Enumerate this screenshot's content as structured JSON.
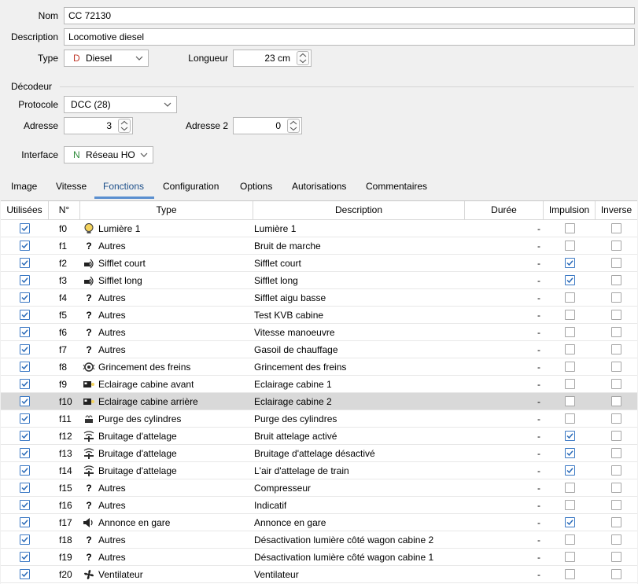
{
  "form": {
    "nom_label": "Nom",
    "nom_value": "CC 72130",
    "description_label": "Description",
    "description_value": "Locomotive diesel",
    "type_label": "Type",
    "type_prefix": "D",
    "type_value": "Diesel",
    "longueur_label": "Longueur",
    "longueur_value": "23 cm"
  },
  "decodeur": {
    "section_label": "Décodeur",
    "protocole_label": "Protocole",
    "protocole_value": "DCC (28)",
    "adresse_label": "Adresse",
    "adresse_value": "3",
    "adresse2_label": "Adresse 2",
    "adresse2_value": "0",
    "interface_label": "Interface",
    "interface_prefix": "N",
    "interface_value": "Réseau HO"
  },
  "colors": {
    "accent": "#3a78c4",
    "type_prefix": "#c0392b",
    "interface_prefix": "#2e8b3a",
    "selected_row": "#d9d9d9"
  },
  "tabs": [
    {
      "label": "Image"
    },
    {
      "label": "Vitesse"
    },
    {
      "label": "Fonctions",
      "active": true
    },
    {
      "label": "Configuration"
    },
    {
      "label": "Options"
    },
    {
      "label": "Autorisations"
    },
    {
      "label": "Commentaires"
    }
  ],
  "table": {
    "headers": [
      "Utilisées",
      "N°",
      "Type",
      "Description",
      "Durée",
      "Impulsion",
      "Inverse"
    ],
    "rows": [
      {
        "used": true,
        "n": "f0",
        "icon": "bulb-icon",
        "type": "Lumière 1",
        "description": "Lumière 1",
        "duree": "-",
        "impulsion": false,
        "inverse": false
      },
      {
        "used": true,
        "n": "f1",
        "icon": "question-icon",
        "type": "Autres",
        "description": "Bruit de marche",
        "duree": "-",
        "impulsion": false,
        "inverse": false
      },
      {
        "used": true,
        "n": "f2",
        "icon": "whistle-icon",
        "type": "Sifflet court",
        "description": "Sifflet court",
        "duree": "-",
        "impulsion": true,
        "inverse": false
      },
      {
        "used": true,
        "n": "f3",
        "icon": "whistle-icon",
        "type": "Sifflet long",
        "description": "Sifflet long",
        "duree": "-",
        "impulsion": true,
        "inverse": false
      },
      {
        "used": true,
        "n": "f4",
        "icon": "question-icon",
        "type": "Autres",
        "description": "Sifflet aigu basse",
        "duree": "-",
        "impulsion": false,
        "inverse": false
      },
      {
        "used": true,
        "n": "f5",
        "icon": "question-icon",
        "type": "Autres",
        "description": "Test KVB cabine",
        "duree": "-",
        "impulsion": false,
        "inverse": false
      },
      {
        "used": true,
        "n": "f6",
        "icon": "question-icon",
        "type": "Autres",
        "description": "Vitesse manoeuvre",
        "duree": "-",
        "impulsion": false,
        "inverse": false
      },
      {
        "used": true,
        "n": "f7",
        "icon": "question-icon",
        "type": "Autres",
        "description": "Gasoil de chauffage",
        "duree": "-",
        "impulsion": false,
        "inverse": false
      },
      {
        "used": true,
        "n": "f8",
        "icon": "brake-icon",
        "type": "Grincement des freins",
        "description": "Grincement des freins",
        "duree": "-",
        "impulsion": false,
        "inverse": false
      },
      {
        "used": true,
        "n": "f9",
        "icon": "cab-light-icon",
        "type": "Eclairage cabine avant",
        "description": "Eclairage cabine 1",
        "duree": "-",
        "impulsion": false,
        "inverse": false
      },
      {
        "used": true,
        "n": "f10",
        "icon": "cab-light-icon",
        "type": "Eclairage cabine arrière",
        "description": "Eclairage cabine 2",
        "duree": "-",
        "impulsion": false,
        "inverse": false,
        "selected": true
      },
      {
        "used": true,
        "n": "f11",
        "icon": "cylinder-purge-icon",
        "type": "Purge des cylindres",
        "description": "Purge des cylindres",
        "duree": "-",
        "impulsion": false,
        "inverse": false
      },
      {
        "used": true,
        "n": "f12",
        "icon": "coupling-icon",
        "type": "Bruitage d'attelage",
        "description": "Bruit attelage activé",
        "duree": "-",
        "impulsion": true,
        "inverse": false
      },
      {
        "used": true,
        "n": "f13",
        "icon": "coupling-icon",
        "type": "Bruitage d'attelage",
        "description": "Bruitage d'attelage désactivé",
        "duree": "-",
        "impulsion": true,
        "inverse": false
      },
      {
        "used": true,
        "n": "f14",
        "icon": "coupling-icon",
        "type": "Bruitage d'attelage",
        "description": "L'air d'attelage de train",
        "duree": "-",
        "impulsion": true,
        "inverse": false
      },
      {
        "used": true,
        "n": "f15",
        "icon": "question-icon",
        "type": "Autres",
        "description": "Compresseur",
        "duree": "-",
        "impulsion": false,
        "inverse": false
      },
      {
        "used": true,
        "n": "f16",
        "icon": "question-icon",
        "type": "Autres",
        "description": "Indicatif",
        "duree": "-",
        "impulsion": false,
        "inverse": false
      },
      {
        "used": true,
        "n": "f17",
        "icon": "speaker-icon",
        "type": "Annonce en gare",
        "description": "Annonce en gare",
        "duree": "-",
        "impulsion": true,
        "inverse": false
      },
      {
        "used": true,
        "n": "f18",
        "icon": "question-icon",
        "type": "Autres",
        "description": "Désactivation lumière côté wagon cabine 2",
        "duree": "-",
        "impulsion": false,
        "inverse": false
      },
      {
        "used": true,
        "n": "f19",
        "icon": "question-icon",
        "type": "Autres",
        "description": "Désactivation lumière côté wagon cabine 1",
        "duree": "-",
        "impulsion": false,
        "inverse": false
      },
      {
        "used": true,
        "n": "f20",
        "icon": "fan-icon",
        "type": "Ventilateur",
        "description": "Ventilateur",
        "duree": "-",
        "impulsion": false,
        "inverse": false
      }
    ]
  }
}
